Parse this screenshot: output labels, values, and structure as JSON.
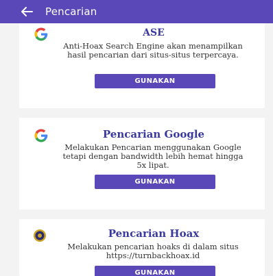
{
  "appbar": {
    "title": "Pencarian",
    "back_icon": "arrow-left-icon"
  },
  "colors": {
    "primary": "#5b48b8",
    "heading": "#3a3a9e",
    "background": "#f3f3f3"
  },
  "cards": [
    {
      "title": "ASE",
      "description": "Anti-Hoax Search Engine akan menampilkan hasil pencarian dari situs-situs terpercaya.",
      "button_label": "GUNAKAN",
      "icon": "google-g-icon"
    },
    {
      "title": "Pencarian Google",
      "description": "Melakukan Pencarian menggunakan Google tetapi dengan bandwidth lebih hemat hingga 5x lipat.",
      "button_label": "GUNAKAN",
      "icon": "google-g-icon"
    },
    {
      "title": "Pencarian Hoax",
      "description": "Melakukan pencarian hoaks di dalam situs https://turnbackhoax.id",
      "button_label": "GUNAKAN",
      "icon": "turnbackhoax-logo-icon"
    }
  ]
}
